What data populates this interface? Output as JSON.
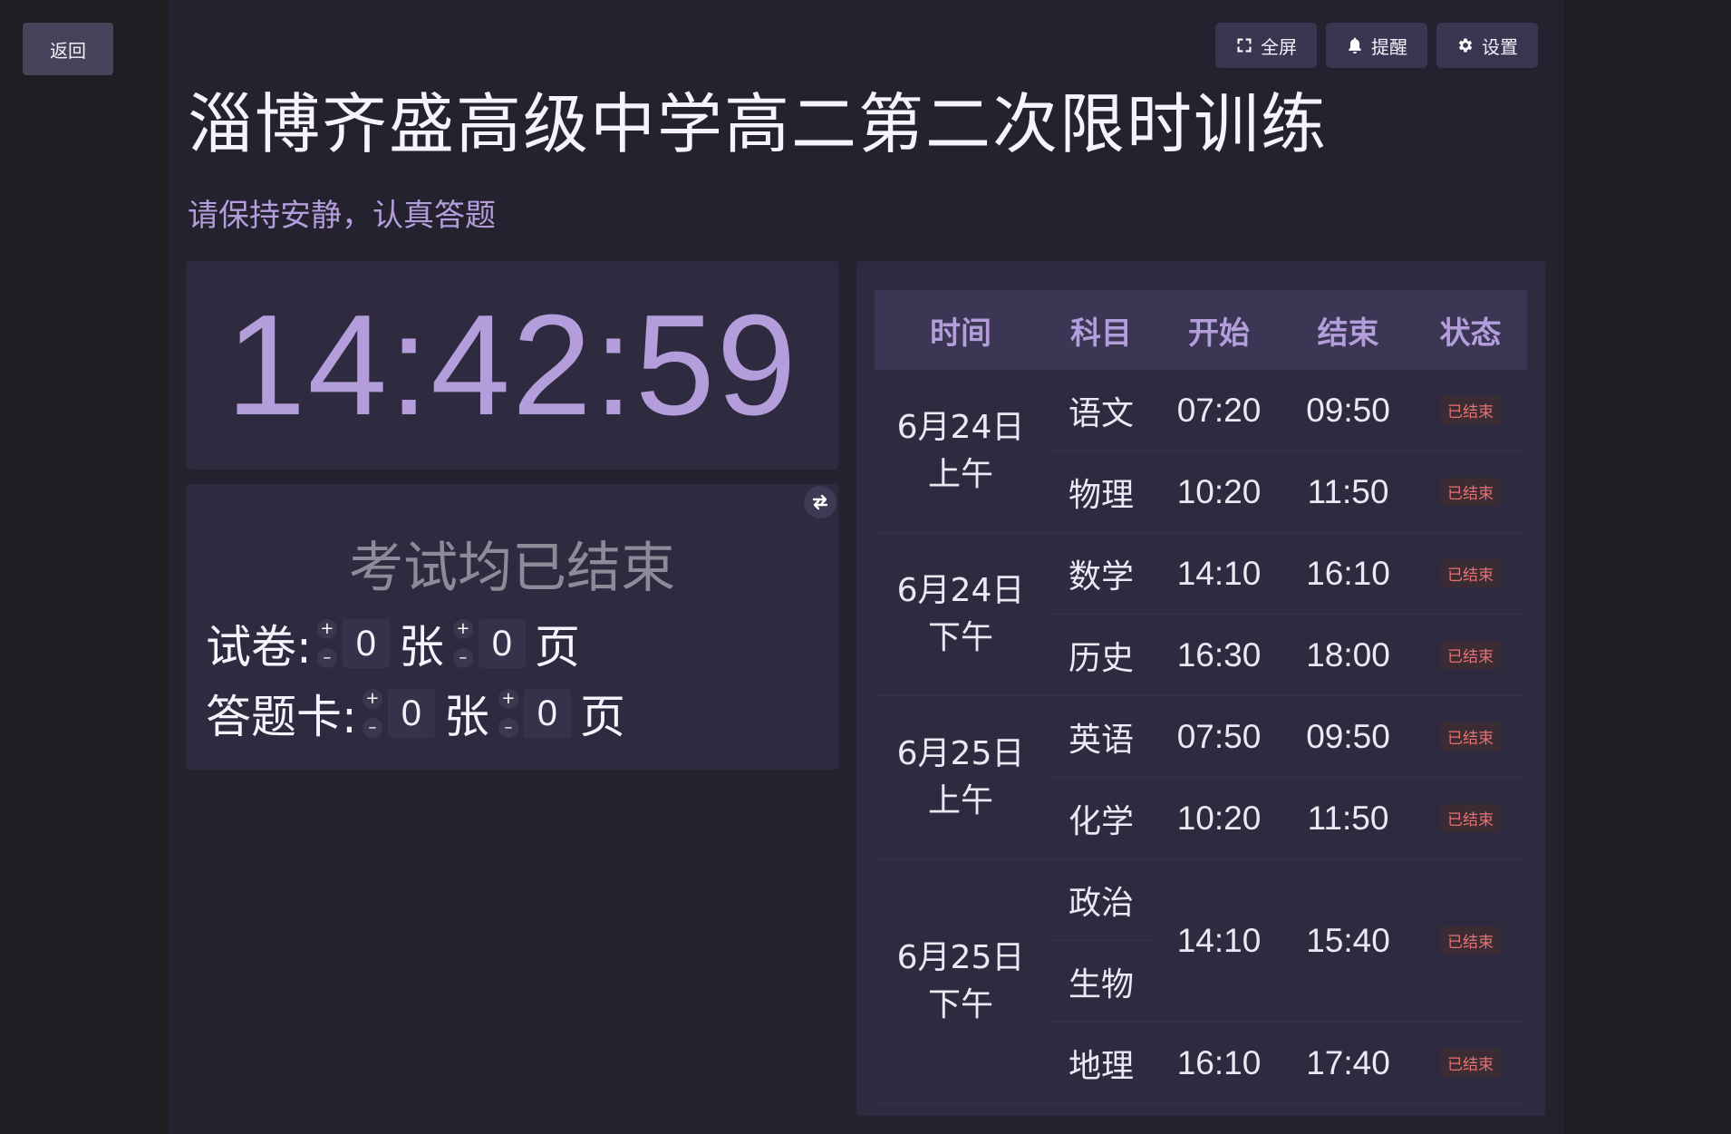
{
  "back_label": "返回",
  "actions": {
    "fullscreen": "全屏",
    "reminder": "提醒",
    "settings": "设置"
  },
  "title": "淄博齐盛高级中学高二第二次限时训练",
  "subtitle": "请保持安静，认真答题",
  "clock": "14:42:59",
  "status_message": "考试均已结束",
  "counts": {
    "paper_label": "试卷:",
    "card_label": "答题卡:",
    "sheet_unit": "张",
    "page_unit": "页",
    "paper_sheets": "0",
    "paper_pages": "0",
    "card_sheets": "0",
    "card_pages": "0",
    "plus": "+",
    "minus": "–"
  },
  "schedule": {
    "headers": {
      "time": "时间",
      "subject": "科目",
      "start": "开始",
      "end": "结束",
      "status": "状态"
    },
    "groups": [
      {
        "day": "6月24日",
        "period": "上午",
        "rows": [
          {
            "subject": "语文",
            "start": "07:20",
            "end": "09:50",
            "status": "已结束"
          },
          {
            "subject": "物理",
            "start": "10:20",
            "end": "11:50",
            "status": "已结束"
          }
        ]
      },
      {
        "day": "6月24日",
        "period": "下午",
        "rows": [
          {
            "subject": "数学",
            "start": "14:10",
            "end": "16:10",
            "status": "已结束"
          },
          {
            "subject": "历史",
            "start": "16:30",
            "end": "18:00",
            "status": "已结束"
          }
        ]
      },
      {
        "day": "6月25日",
        "period": "上午",
        "rows": [
          {
            "subject": "英语",
            "start": "07:50",
            "end": "09:50",
            "status": "已结束"
          },
          {
            "subject": "化学",
            "start": "10:20",
            "end": "11:50",
            "status": "已结束"
          }
        ]
      },
      {
        "day": "6月25日",
        "period": "下午",
        "combined": {
          "subjects": [
            "政治",
            "生物"
          ],
          "start": "14:10",
          "end": "15:40",
          "status": "已结束"
        },
        "rows": [
          {
            "subject": "地理",
            "start": "16:10",
            "end": "17:40",
            "status": "已结束"
          }
        ]
      }
    ]
  },
  "colors": {
    "accent": "#b39ddb",
    "badge_text": "#e57373"
  }
}
